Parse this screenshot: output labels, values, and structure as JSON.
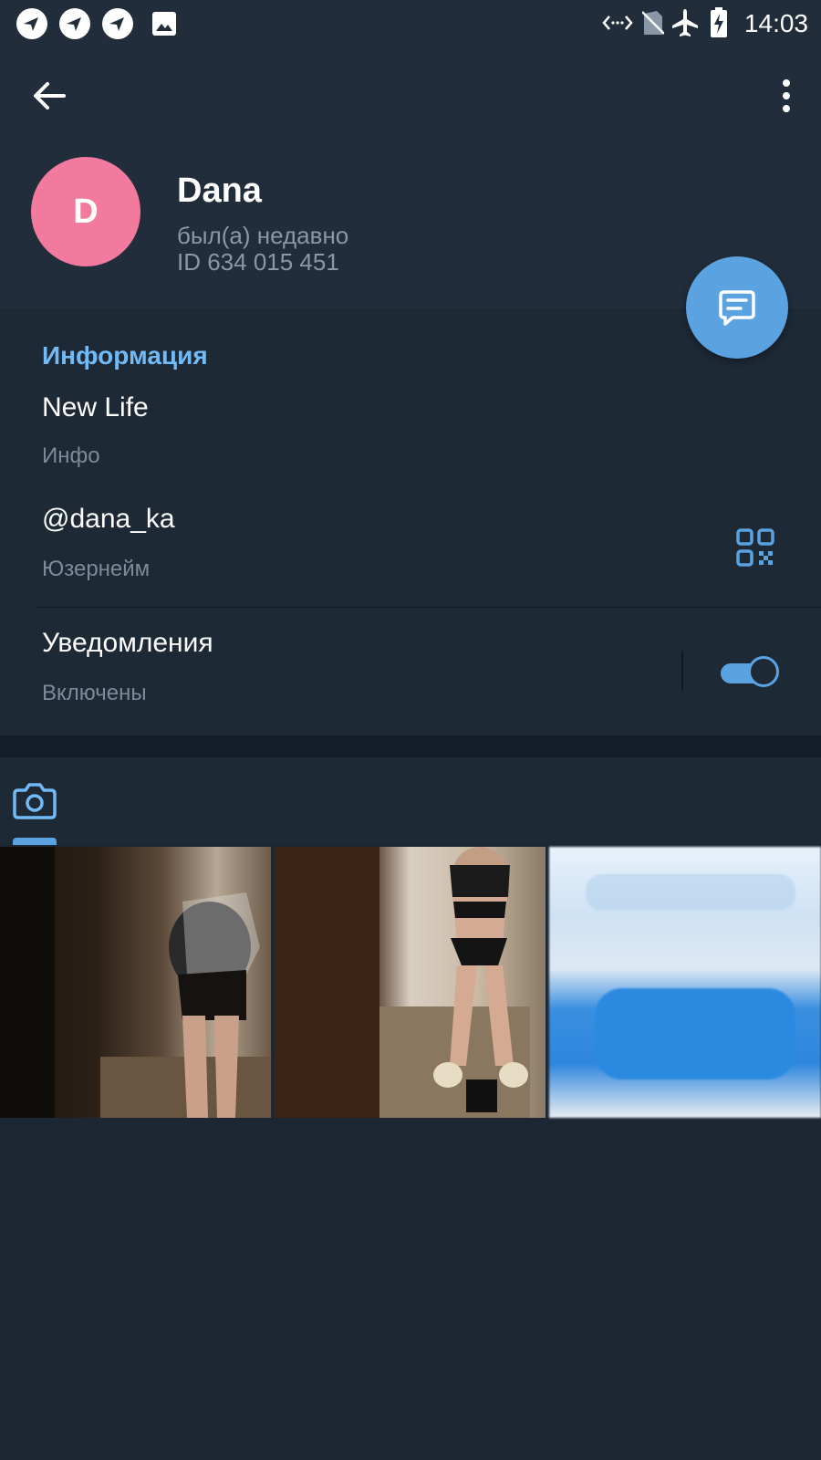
{
  "status_bar": {
    "time": "14:03",
    "left_icons": [
      "app-notification-icon",
      "app-notification-icon",
      "app-notification-icon",
      "image-icon"
    ],
    "right_icons": [
      "data-transfer-icon",
      "no-sim-icon",
      "airplane-mode-icon",
      "battery-charging-icon"
    ]
  },
  "profile": {
    "avatar_letter": "D",
    "avatar_color": "#f27a9e",
    "name": "Dana",
    "status": "был(а) недавно",
    "id_text": "ID 634 015 451"
  },
  "info": {
    "section_title": "Информация",
    "bio_value": "New Life",
    "bio_label": "Инфо",
    "username_value": "@dana_ka",
    "username_label": "Юзернейм",
    "notifications_value": "Уведомления",
    "notifications_label": "Включены",
    "notifications_enabled": true
  },
  "media": {
    "active_tab": "photos",
    "photo_count_shown": 3
  },
  "colors": {
    "accent": "#5aa3e0",
    "section_title": "#71baf7",
    "background": "#1d2733",
    "header": "#212d3b"
  }
}
